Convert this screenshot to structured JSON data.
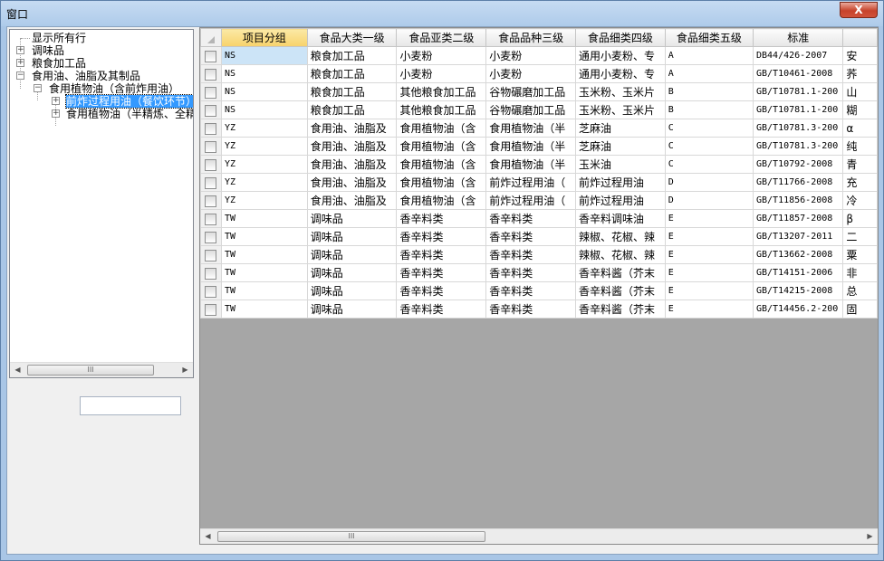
{
  "window": {
    "title": "窗口",
    "close_label": "X"
  },
  "tree": {
    "items": [
      {
        "label": "显示所有行",
        "expander": ""
      },
      {
        "label": "调味品",
        "expander": "+"
      },
      {
        "label": "粮食加工品",
        "expander": "+"
      },
      {
        "label": "食用油、油脂及其制品",
        "expander": "−"
      },
      {
        "label": "食用植物油（含前炸用油）",
        "expander": "−"
      },
      {
        "label": "前炸过程用油（餐饮环节）",
        "expander": "+",
        "selected": true
      },
      {
        "label": "食用植物油（半精炼、全精",
        "expander": "+"
      }
    ],
    "scroll_thumb_glyph": "III"
  },
  "filter": {
    "value": ""
  },
  "grid": {
    "columns": [
      "项目分组",
      "食品大类一级",
      "食品亚类二级",
      "食品品种三级",
      "食品细类四级",
      "食品细类五级",
      "标准",
      ""
    ],
    "rows": [
      [
        "NS",
        "粮食加工品",
        "小麦粉",
        "小麦粉",
        "通用小麦粉、专",
        "A",
        "DB44/426-2007",
        "安"
      ],
      [
        "NS",
        "粮食加工品",
        "小麦粉",
        "小麦粉",
        "通用小麦粉、专",
        "A",
        "GB/T10461-2008",
        "荞"
      ],
      [
        "NS",
        "粮食加工品",
        "其他粮食加工品",
        "谷物碾磨加工品",
        "玉米粉、玉米片",
        "B",
        "GB/T10781.1-200",
        "山"
      ],
      [
        "NS",
        "粮食加工品",
        "其他粮食加工品",
        "谷物碾磨加工品",
        "玉米粉、玉米片",
        "B",
        "GB/T10781.1-200",
        "糊"
      ],
      [
        "YZ",
        "食用油、油脂及",
        "食用植物油（含",
        "食用植物油（半",
        "芝麻油",
        "C",
        "GB/T10781.3-200",
        "α"
      ],
      [
        "YZ",
        "食用油、油脂及",
        "食用植物油（含",
        "食用植物油（半",
        "芝麻油",
        "C",
        "GB/T10781.3-200",
        "纯"
      ],
      [
        "YZ",
        "食用油、油脂及",
        "食用植物油（含",
        "食用植物油（半",
        "玉米油",
        "C",
        "GB/T10792-2008",
        "青"
      ],
      [
        "YZ",
        "食用油、油脂及",
        "食用植物油（含",
        "前炸过程用油（",
        "前炸过程用油",
        "D",
        "GB/T11766-2008",
        "充"
      ],
      [
        "YZ",
        "食用油、油脂及",
        "食用植物油（含",
        "前炸过程用油（",
        "前炸过程用油",
        "D",
        "GB/T11856-2008",
        "冷"
      ],
      [
        "TW",
        "调味品",
        "香辛料类",
        "香辛料类",
        "香辛料调味油",
        "E",
        "GB/T11857-2008",
        "β"
      ],
      [
        "TW",
        "调味品",
        "香辛料类",
        "香辛料类",
        "辣椒、花椒、辣",
        "E",
        "GB/T13207-2011",
        "二"
      ],
      [
        "TW",
        "调味品",
        "香辛料类",
        "香辛料类",
        "辣椒、花椒、辣",
        "E",
        "GB/T13662-2008",
        "粟"
      ],
      [
        "TW",
        "调味品",
        "香辛料类",
        "香辛料类",
        "香辛料酱（芥末",
        "E",
        "GB/T14151-2006",
        "非"
      ],
      [
        "TW",
        "调味品",
        "香辛料类",
        "香辛料类",
        "香辛料酱（芥末",
        "E",
        "GB/T14215-2008",
        "总"
      ],
      [
        "TW",
        "调味品",
        "香辛料类",
        "香辛料类",
        "香辛料酱（芥末",
        "E",
        "GB/T14456.2-200",
        "固"
      ]
    ],
    "scroll_thumb_glyph": "III",
    "highlight_color": "#f7d26b",
    "selection_color": "#3399ff"
  }
}
